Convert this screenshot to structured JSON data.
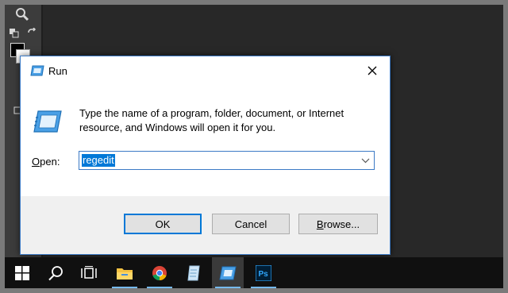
{
  "dialog": {
    "title": "Run",
    "description": "Type the name of a program, folder, document, or Internet resource, and Windows will open it for you.",
    "open_label_mnemonic": "O",
    "open_label_rest": "pen:",
    "open_value": "regedit",
    "buttons": {
      "ok": "OK",
      "cancel": "Cancel",
      "browse_mnemonic": "B",
      "browse_rest": "rowse..."
    }
  },
  "taskbar": {
    "items": [
      "start-icon",
      "search-icon",
      "task-view-icon",
      "file-explorer-icon",
      "chrome-icon",
      "notepad-icon",
      "run-icon",
      "photoshop-icon"
    ],
    "photoshop_label": "Ps"
  },
  "colors": {
    "accent": "#0078d7",
    "taskbar": "#101010",
    "dialog_footer": "#f0f0f0"
  }
}
